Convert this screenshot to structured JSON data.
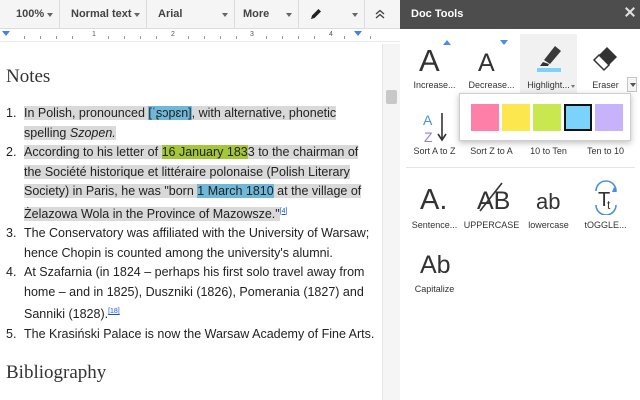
{
  "toolbar": {
    "zoom": "100%",
    "style": "Normal text",
    "font": "Arial",
    "more": "More",
    "pen_icon": "pen-icon",
    "collapse_icon": "collapse-chevron-icon"
  },
  "ruler": {
    "numbers": [
      "1",
      "2",
      "3",
      "4"
    ]
  },
  "document": {
    "heading": "Notes",
    "notes": [
      {
        "number": "1.",
        "parts": [
          "In Polish, pronounced ",
          "[ˈʂɔpɛn]",
          ", with alternative, phonetic spelling ",
          "Szopen."
        ]
      },
      {
        "number": "2.",
        "parts": [
          "According to his letter of ",
          "16 January 183",
          "3 to the chairman of the Société historique et littéraire polonaise (Polish Literary Society) in Paris, he was \"born ",
          "1 March 1810",
          " at the village of Żelazowa Wola in the Province of Mazowsze.\"",
          "[4]"
        ]
      },
      {
        "number": "3.",
        "parts": [
          "The Conservatory was affiliated with the University of Warsaw; hence Chopin is counted among the university's alumni."
        ]
      },
      {
        "number": "4.",
        "parts": [
          "At Szafarnia (in 1824 – perhaps his first solo travel away from home – and in 1825), Duszniki (1826), Pomerania (1827) and Sanniki (1828).",
          "[18]"
        ]
      },
      {
        "number": "5.",
        "parts": [
          "The Krasiński Palace is now the Warsaw Academy of Fine Arts."
        ]
      }
    ],
    "bibliography_heading": "Bibliography"
  },
  "sidebar": {
    "title": "Doc Tools",
    "tools": [
      {
        "label": "Increase...",
        "icon": "increase-font-icon"
      },
      {
        "label": "Decrease...",
        "icon": "decrease-font-icon"
      },
      {
        "label": "Highlight...",
        "icon": "highlighter-icon"
      },
      {
        "label": "Eraser",
        "icon": "eraser-icon"
      },
      {
        "label": "Sort A to Z",
        "icon": "sort-a-to-z-icon"
      },
      {
        "label": "Sort Z to A",
        "icon": "sort-z-to-a-icon"
      },
      {
        "label": "10 to Ten",
        "icon": "number-to-word-icon"
      },
      {
        "label": "Ten to 10",
        "icon": "word-to-number-icon"
      },
      {
        "label": "Sentence...",
        "icon": "sentence-case-icon"
      },
      {
        "label": "UPPERCASE",
        "icon": "uppercase-icon"
      },
      {
        "label": "lowercase",
        "icon": "lowercase-icon"
      },
      {
        "label": "tOGGLE...",
        "icon": "toggle-case-icon"
      },
      {
        "label": "Capitalize",
        "icon": "capitalize-icon"
      }
    ],
    "glyphs": {
      "increase": "A",
      "decrease": "A",
      "sort_a": "A",
      "sort_z": "Z",
      "sentence": "A.",
      "uppercase": "AB",
      "lowercase": "ab",
      "toggle": "T",
      "toggle_small": "t",
      "capitalize": "Ab"
    },
    "palette": {
      "colors": [
        "#fe7fa8",
        "#fde74f",
        "#c9e84f",
        "#7bd3fb",
        "#c6b3fb"
      ],
      "selected_index": 3
    }
  },
  "colors": {
    "header_bg": "#4d4d4d",
    "highlight_green": "#a4c639",
    "highlight_blue": "#6fb8d8",
    "selection_gray": "#d9d9d9",
    "accent_blue": "#4a7ee6"
  }
}
